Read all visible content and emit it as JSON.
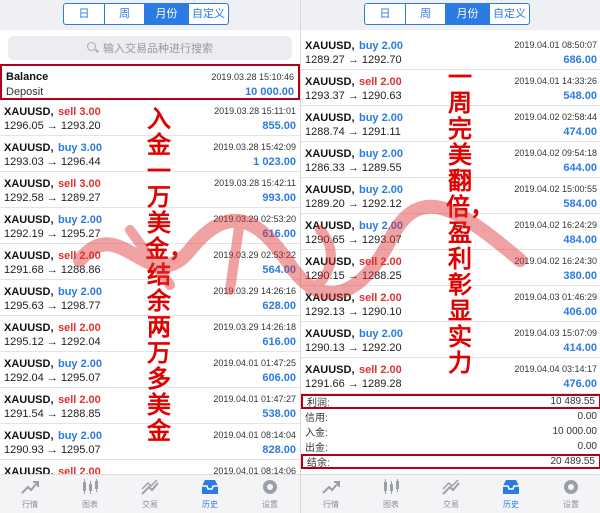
{
  "period_tabs": [
    "日",
    "周",
    "月份",
    "自定义"
  ],
  "active_period": 2,
  "search": {
    "placeholder": "输入交易品种进行搜索"
  },
  "left": {
    "balance": {
      "title": "Balance",
      "date": "2019.03.28 15:10:46",
      "label": "Deposit",
      "amount": "10 000.00"
    },
    "trades": [
      {
        "symbol": "XAUUSD,",
        "side": "sell 3.00",
        "type": "sell",
        "date": "2019.03.28 15:11:01",
        "prices": "1296.05 → 1293.20",
        "profit": "855.00"
      },
      {
        "symbol": "XAUUSD,",
        "side": "buy 3.00",
        "type": "buy",
        "date": "2019.03.28 15:42:09",
        "prices": "1293.03 → 1296.44",
        "profit": "1 023.00"
      },
      {
        "symbol": "XAUUSD,",
        "side": "sell 3.00",
        "type": "sell",
        "date": "2019.03.28 15:42:11",
        "prices": "1292.58 → 1289.27",
        "profit": "993.00"
      },
      {
        "symbol": "XAUUSD,",
        "side": "buy 2.00",
        "type": "buy",
        "date": "2019.03.29 02:53:20",
        "prices": "1292.19 → 1295.27",
        "profit": "616.00"
      },
      {
        "symbol": "XAUUSD,",
        "side": "sell 2.00",
        "type": "sell",
        "date": "2019.03.29 02:53:22",
        "prices": "1291.68 → 1288.86",
        "profit": "564.00"
      },
      {
        "symbol": "XAUUSD,",
        "side": "buy 2.00",
        "type": "buy",
        "date": "2019.03.29 14:26:16",
        "prices": "1295.63 → 1298.77",
        "profit": "628.00"
      },
      {
        "symbol": "XAUUSD,",
        "side": "sell 2.00",
        "type": "sell",
        "date": "2019.03.29 14:26:18",
        "prices": "1295.12 → 1292.04",
        "profit": "616.00"
      },
      {
        "symbol": "XAUUSD,",
        "side": "buy 2.00",
        "type": "buy",
        "date": "2019.04.01 01:47:25",
        "prices": "1292.04 → 1295.07",
        "profit": "606.00"
      },
      {
        "symbol": "XAUUSD,",
        "side": "sell 2.00",
        "type": "sell",
        "date": "2019.04.01 01:47:27",
        "prices": "1291.54 → 1288.85",
        "profit": "538.00"
      },
      {
        "symbol": "XAUUSD,",
        "side": "buy 2.00",
        "type": "buy",
        "date": "2019.04.01 08:14:04",
        "prices": "1290.93 → 1295.07",
        "profit": "828.00"
      },
      {
        "symbol": "XAUUSD,",
        "side": "sell 2.00",
        "type": "sell",
        "date": "2019.04.01 08:14:06",
        "prices": "",
        "profit": ""
      }
    ],
    "overlay": "入金一万美金，结余两万多美金"
  },
  "right": {
    "trades": [
      {
        "symbol": "XAUUSD,",
        "side": "buy 2.00",
        "type": "buy",
        "date": "2019.04.01 08:50:07",
        "prices": "1289.27 → 1292.70",
        "profit": "686.00"
      },
      {
        "symbol": "XAUUSD,",
        "side": "sell 2.00",
        "type": "sell",
        "date": "2019.04.01 14:33:26",
        "prices": "1293.37 → 1290.63",
        "profit": "548.00"
      },
      {
        "symbol": "XAUUSD,",
        "side": "buy 2.00",
        "type": "buy",
        "date": "2019.04.02 02:58:44",
        "prices": "1288.74 → 1291.11",
        "profit": "474.00"
      },
      {
        "symbol": "XAUUSD,",
        "side": "buy 2.00",
        "type": "buy",
        "date": "2019.04.02 09:54:18",
        "prices": "1286.33 → 1289.55",
        "profit": "644.00"
      },
      {
        "symbol": "XAUUSD,",
        "side": "buy 2.00",
        "type": "buy",
        "date": "2019.04.02 15:00:55",
        "prices": "1289.20 → 1292.12",
        "profit": "584.00"
      },
      {
        "symbol": "XAUUSD,",
        "side": "buy 2.00",
        "type": "buy",
        "date": "2019.04.02 16:24:29",
        "prices": "1290.65 → 1293.07",
        "profit": "484.00"
      },
      {
        "symbol": "XAUUSD,",
        "side": "sell 2.00",
        "type": "sell",
        "date": "2019.04.02 16:24:30",
        "prices": "1290.15 → 1288.25",
        "profit": "380.00"
      },
      {
        "symbol": "XAUUSD,",
        "side": "sell 2.00",
        "type": "sell",
        "date": "2019.04.03 01:46:29",
        "prices": "1292.13 → 1290.10",
        "profit": "406.00"
      },
      {
        "symbol": "XAUUSD,",
        "side": "buy 2.00",
        "type": "buy",
        "date": "2019.04.03 15:07:09",
        "prices": "1290.13 → 1292.20",
        "profit": "414.00"
      },
      {
        "symbol": "XAUUSD,",
        "side": "sell 2.00",
        "type": "sell",
        "date": "2019.04.04 03:14:17",
        "prices": "1291.66 → 1289.28",
        "profit": "476.00"
      }
    ],
    "summary": [
      {
        "label": "利润:",
        "value": "10 489.55",
        "boxed": true
      },
      {
        "label": "信用:",
        "value": "0.00",
        "boxed": false
      },
      {
        "label": "入金:",
        "value": "10 000.00",
        "boxed": false
      },
      {
        "label": "出金:",
        "value": "0.00",
        "boxed": false
      },
      {
        "label": "结余:",
        "value": "20 489.55",
        "boxed": true
      }
    ],
    "overlay": "一周完美翻倍，盈利彰显实力"
  },
  "tabbar": [
    {
      "label": "行情",
      "icon": "quotes-icon"
    },
    {
      "label": "图表",
      "icon": "chart-icon"
    },
    {
      "label": "交易",
      "icon": "trade-icon"
    },
    {
      "label": "历史",
      "icon": "history-icon"
    },
    {
      "label": "设置",
      "icon": "settings-icon"
    }
  ],
  "active_tab": 3,
  "colors": {
    "accent": "#2c7be5",
    "sell": "#e03131",
    "highlight_box": "#b00018",
    "overlay_text": "#e00000"
  }
}
